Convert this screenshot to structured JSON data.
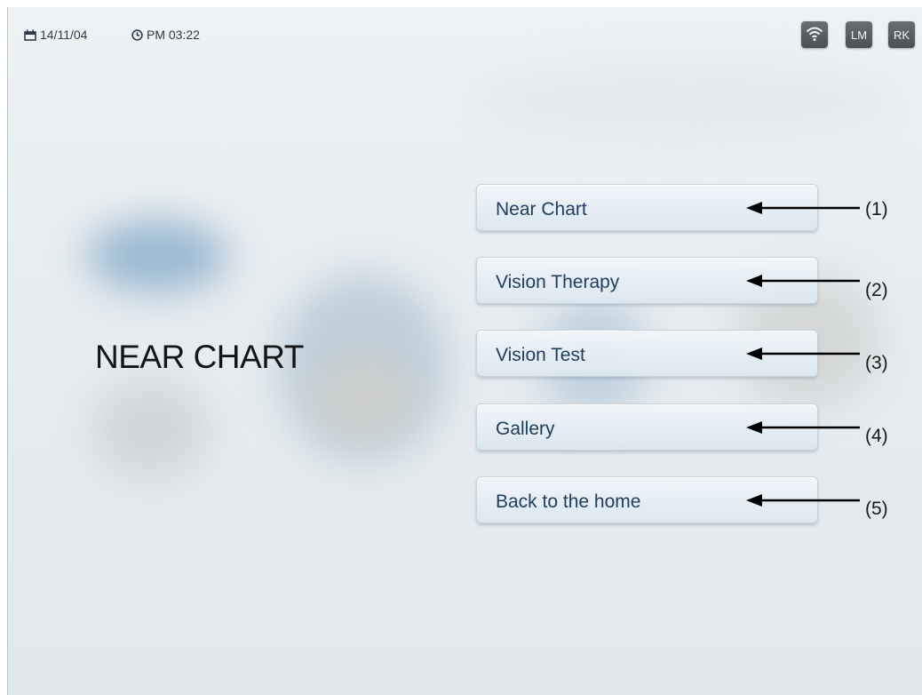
{
  "header": {
    "date": "14/11/04",
    "time": "PM 03:22",
    "status_buttons": [
      {
        "label": "",
        "icon": "wifi-icon"
      },
      {
        "label": "LM"
      },
      {
        "label": "RK"
      }
    ]
  },
  "page_title": "NEAR CHART",
  "menu": [
    {
      "label": "Near Chart",
      "callout": "(1)"
    },
    {
      "label": "Vision Therapy",
      "callout": "(2)"
    },
    {
      "label": "Vision Test",
      "callout": "(3)"
    },
    {
      "label": "Gallery",
      "callout": "(4)"
    },
    {
      "label": "Back to the home",
      "callout": "(5)"
    }
  ],
  "colors": {
    "button_text": "#1f3d5c",
    "status_button_bg": "#55595d",
    "arrow": "#000000"
  }
}
